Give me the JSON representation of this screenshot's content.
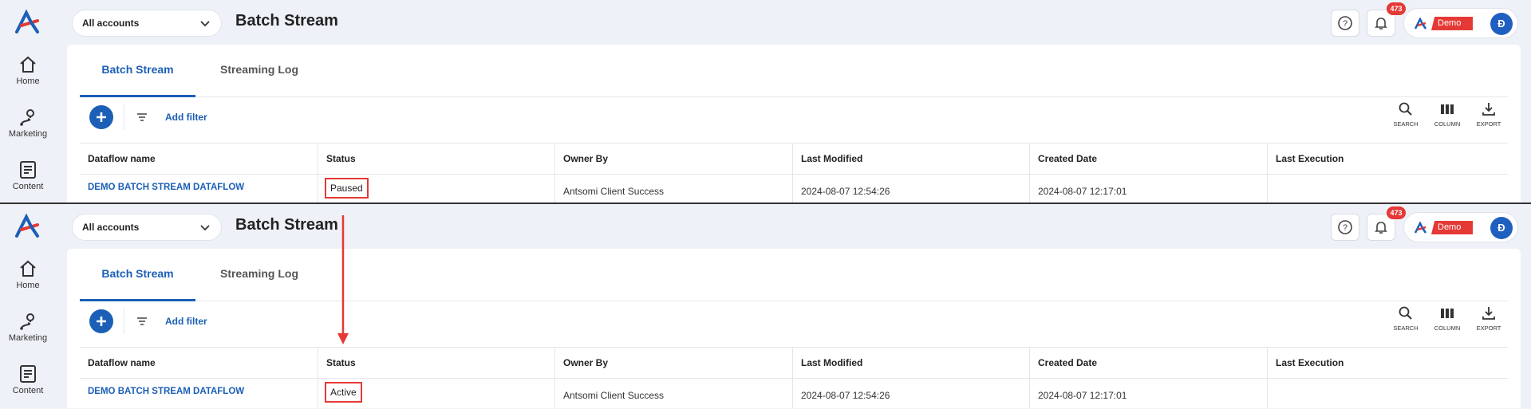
{
  "sidebar": {
    "items": [
      {
        "label": "Home",
        "icon": "home-icon"
      },
      {
        "label": "Marketing",
        "icon": "route-pin-icon"
      },
      {
        "label": "Content",
        "icon": "document-icon"
      }
    ]
  },
  "header": {
    "account_select": "All accounts",
    "title": "Batch Stream",
    "notification_count": "473",
    "demo_label": "Demo",
    "avatar_initial": "Đ"
  },
  "tabs": [
    {
      "label": "Batch Stream",
      "active": true
    },
    {
      "label": "Streaming Log",
      "active": false
    }
  ],
  "toolbar": {
    "add_filter": "Add filter",
    "search": "SEARCH",
    "column": "COLUMN",
    "export": "EXPORT"
  },
  "table": {
    "headers": [
      "Dataflow name",
      "Status",
      "Owner By",
      "Last Modified",
      "Created Date",
      "Last Execution"
    ]
  },
  "before": {
    "row": {
      "name": "DEMO BATCH STREAM DATAFLOW",
      "status": "Paused",
      "owner": "Antsomi Client Success",
      "last_modified": "2024-08-07 12:54:26",
      "created": "2024-08-07 12:17:01",
      "last_execution": ""
    }
  },
  "after": {
    "row": {
      "name": "DEMO BATCH STREAM DATAFLOW",
      "status": "Active",
      "owner": "Antsomi Client Success",
      "last_modified": "2024-08-07 12:54:26",
      "created": "2024-08-07 12:17:01",
      "last_execution": ""
    }
  },
  "colors": {
    "brand_blue": "#1b5fb6",
    "highlight_red": "#e53935"
  }
}
